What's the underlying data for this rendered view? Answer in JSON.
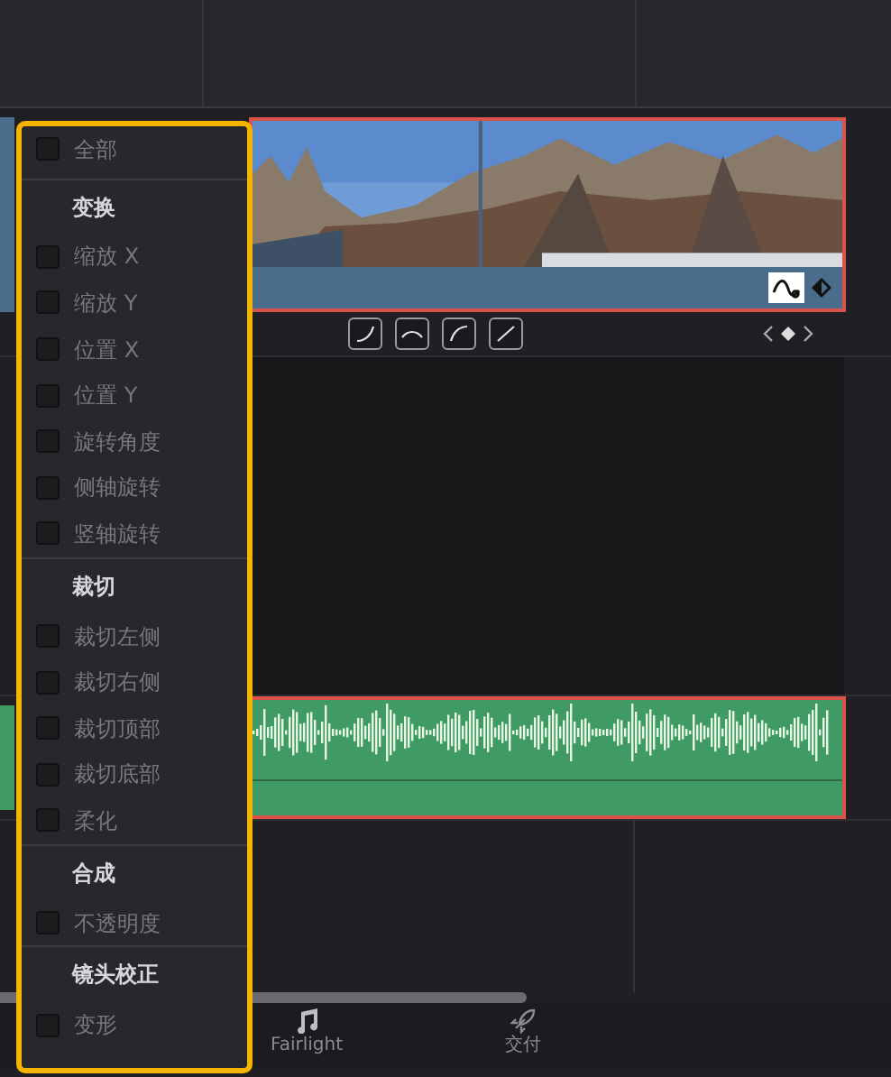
{
  "timeline": {
    "video_clip": {
      "selected": true
    },
    "audio_clip": {
      "selected": true
    }
  },
  "menu": {
    "sections": [
      {
        "items": [
          {
            "label": "全部",
            "checked": false
          }
        ]
      },
      {
        "title": "变换",
        "items": [
          {
            "label": "缩放 X",
            "checked": false
          },
          {
            "label": "缩放 Y",
            "checked": false
          },
          {
            "label": "位置 X",
            "checked": false
          },
          {
            "label": "位置 Y",
            "checked": false
          },
          {
            "label": "旋转角度",
            "checked": false
          },
          {
            "label": "侧轴旋转",
            "checked": false
          },
          {
            "label": "竖轴旋转",
            "checked": false
          }
        ]
      },
      {
        "title": "裁切",
        "items": [
          {
            "label": "裁切左侧",
            "checked": false
          },
          {
            "label": "裁切右侧",
            "checked": false
          },
          {
            "label": "裁切顶部",
            "checked": false
          },
          {
            "label": "裁切底部",
            "checked": false
          },
          {
            "label": "柔化",
            "checked": false
          }
        ]
      },
      {
        "title": "合成",
        "items": [
          {
            "label": "不透明度",
            "checked": false
          }
        ]
      },
      {
        "title": "镜头校正",
        "items": [
          {
            "label": "变形",
            "checked": false
          }
        ]
      }
    ]
  },
  "bottom_bar": {
    "items": [
      {
        "kind": "music",
        "label": "Fairlight"
      },
      {
        "kind": "deliver",
        "label": "交付"
      }
    ]
  }
}
